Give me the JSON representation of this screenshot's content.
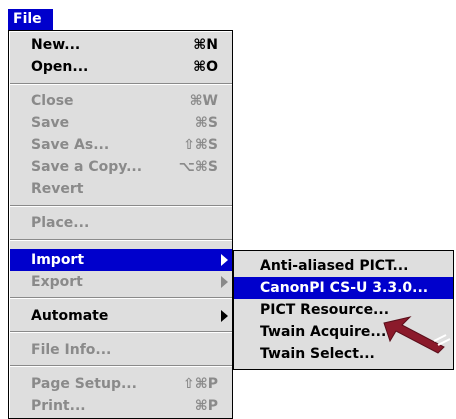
{
  "menubar": {
    "title": "File"
  },
  "menu": {
    "items": [
      {
        "label": "New...",
        "shortcut": "⌘N",
        "disabled": false
      },
      {
        "label": "Open...",
        "shortcut": "⌘O",
        "disabled": false
      },
      {
        "label": "Close",
        "shortcut": "⌘W",
        "disabled": true
      },
      {
        "label": "Save",
        "shortcut": "⌘S",
        "disabled": true
      },
      {
        "label": "Save As...",
        "shortcut": "⇧⌘S",
        "disabled": true
      },
      {
        "label": "Save a Copy...",
        "shortcut": "⌥⌘S",
        "disabled": true
      },
      {
        "label": "Revert",
        "shortcut": "",
        "disabled": true
      },
      {
        "label": "Place...",
        "shortcut": "",
        "disabled": true
      },
      {
        "label": "Import",
        "shortcut": "",
        "disabled": false,
        "submenu": true,
        "highlighted": true
      },
      {
        "label": "Export",
        "shortcut": "",
        "disabled": true,
        "submenu": true
      },
      {
        "label": "Automate",
        "shortcut": "",
        "disabled": false,
        "submenu": true
      },
      {
        "label": "File Info...",
        "shortcut": "",
        "disabled": true
      },
      {
        "label": "Page Setup...",
        "shortcut": "⇧⌘P",
        "disabled": true
      },
      {
        "label": "Print...",
        "shortcut": "⌘P",
        "disabled": true
      }
    ]
  },
  "submenu": {
    "items": [
      {
        "label": "Anti-aliased PICT...",
        "highlighted": false
      },
      {
        "label": "CanonPI CS-U 3.3.0...",
        "highlighted": true
      },
      {
        "label": "PICT Resource...",
        "highlighted": false
      },
      {
        "label": "Twain Acquire...",
        "highlighted": false
      },
      {
        "label": "Twain Select...",
        "highlighted": false
      }
    ]
  },
  "colors": {
    "highlight": "#0000cc",
    "menu_bg": "#dedede",
    "disabled_text": "#8a8a8a",
    "pointer": "#8b1a2b"
  },
  "pointer": {
    "icon": "arrow-pointer-icon"
  }
}
